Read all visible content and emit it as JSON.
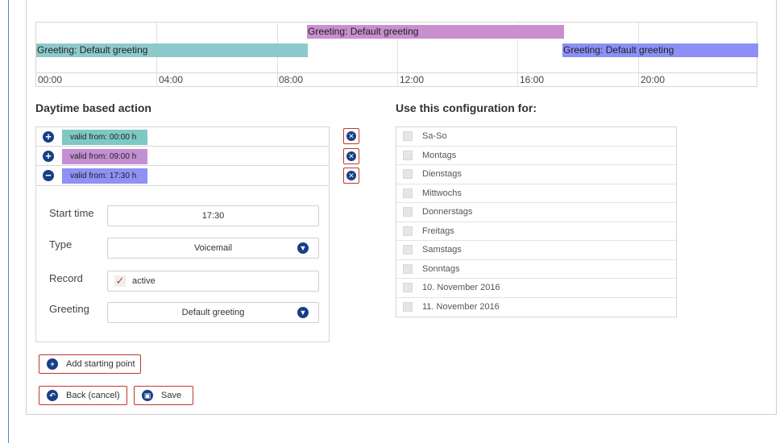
{
  "timeline": {
    "bars": [
      {
        "label": "Greeting: Default greeting",
        "color": "#c98fcf"
      },
      {
        "label": "Greeting: Default greeting",
        "color": "#8ec9cb"
      },
      {
        "label": "Greeting: Default greeting",
        "color": "#8b8ff6"
      }
    ],
    "ticks": [
      "00:00",
      "04:00",
      "08:00",
      "12:00",
      "16:00",
      "20:00"
    ]
  },
  "daytime": {
    "heading": "Daytime based action",
    "actions": [
      {
        "label": "valid from: 00:00 h",
        "color": "#7ec8c5",
        "icon": "plus-icon",
        "glyph": "+"
      },
      {
        "label": "valid from: 09:00 h",
        "color": "#c58fd3",
        "icon": "plus-icon",
        "glyph": "+"
      },
      {
        "label": "valid from: 17:30 h",
        "color": "#8f91f5",
        "icon": "minus-icon",
        "glyph": "−"
      }
    ],
    "form": {
      "start_label": "Start time",
      "start_value": "17:30",
      "type_label": "Type",
      "type_value": "Voicemail",
      "record_label": "Record",
      "record_value": "active",
      "record_checked": true,
      "greeting_label": "Greeting",
      "greeting_value": "Default greeting"
    }
  },
  "config": {
    "heading": "Use this configuration for:",
    "items": [
      "Sa-So",
      "Montags",
      "Dienstags",
      "Mittwochs",
      "Donnerstags",
      "Freitags",
      "Samstags",
      "Sonntags",
      "10. November 2016",
      "11. November 2016"
    ]
  },
  "buttons": {
    "add_label": "Add starting point",
    "back_label": "Back (cancel)",
    "save_label": "Save"
  },
  "colors": {
    "accent": "#173f86",
    "danger_border": "#c0392b"
  }
}
